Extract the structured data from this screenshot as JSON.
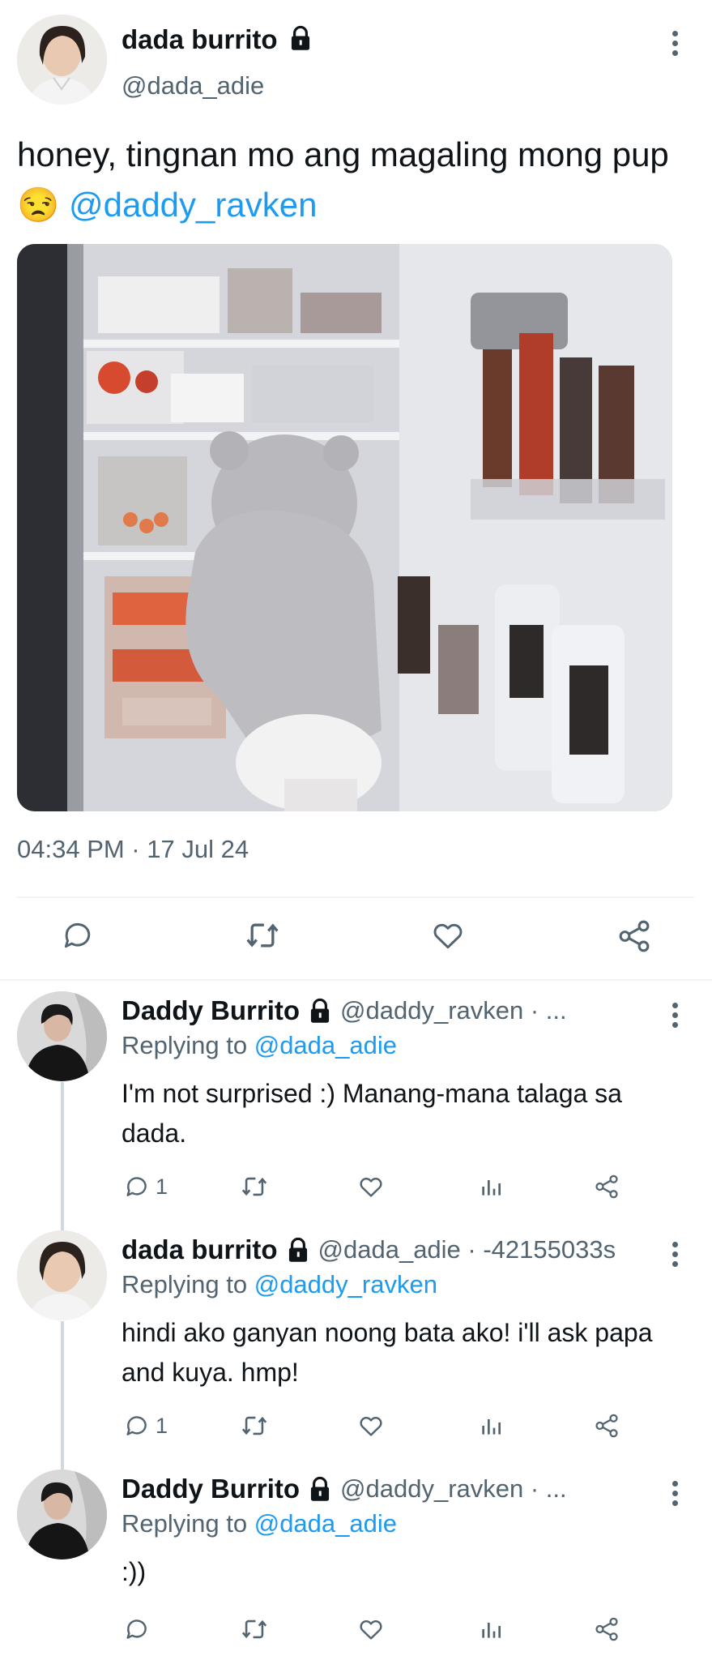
{
  "main_tweet": {
    "author_name": "dada burrito",
    "author_handle": "@dada_adie",
    "text_line1": "honey, tingnan mo ang magaling mong pup",
    "emoji": "😒",
    "mention": "@daddy_ravken",
    "timestamp": "04:34 PM · 17 Jul 24",
    "icons": [
      "comment-icon",
      "retweet-icon",
      "heart-icon",
      "share-icon"
    ]
  },
  "replies": [
    {
      "author_name": "Daddy Burrito",
      "author_handle": "@daddy_ravken · ...",
      "replying_label": "Replying to",
      "replying_to": "@dada_adie",
      "text": "I'm not surprised :) Manang-mana talaga sa dada.",
      "reply_count": "1"
    },
    {
      "author_name": "dada burrito",
      "author_handle": "@dada_adie · -42155033s",
      "replying_label": "Replying to",
      "replying_to": "@daddy_ravken",
      "text": "hindi ako ganyan noong bata ako! i'll ask papa and kuya. hmp!",
      "reply_count": "1"
    },
    {
      "author_name": "Daddy Burrito",
      "author_handle": "@daddy_ravken · ...",
      "replying_label": "Replying to",
      "replying_to": "@dada_adie",
      "text": ":))",
      "reply_count": ""
    }
  ],
  "colors": {
    "accent": "#1d9bf0",
    "muted": "#536471",
    "divider": "#eff3f4"
  }
}
